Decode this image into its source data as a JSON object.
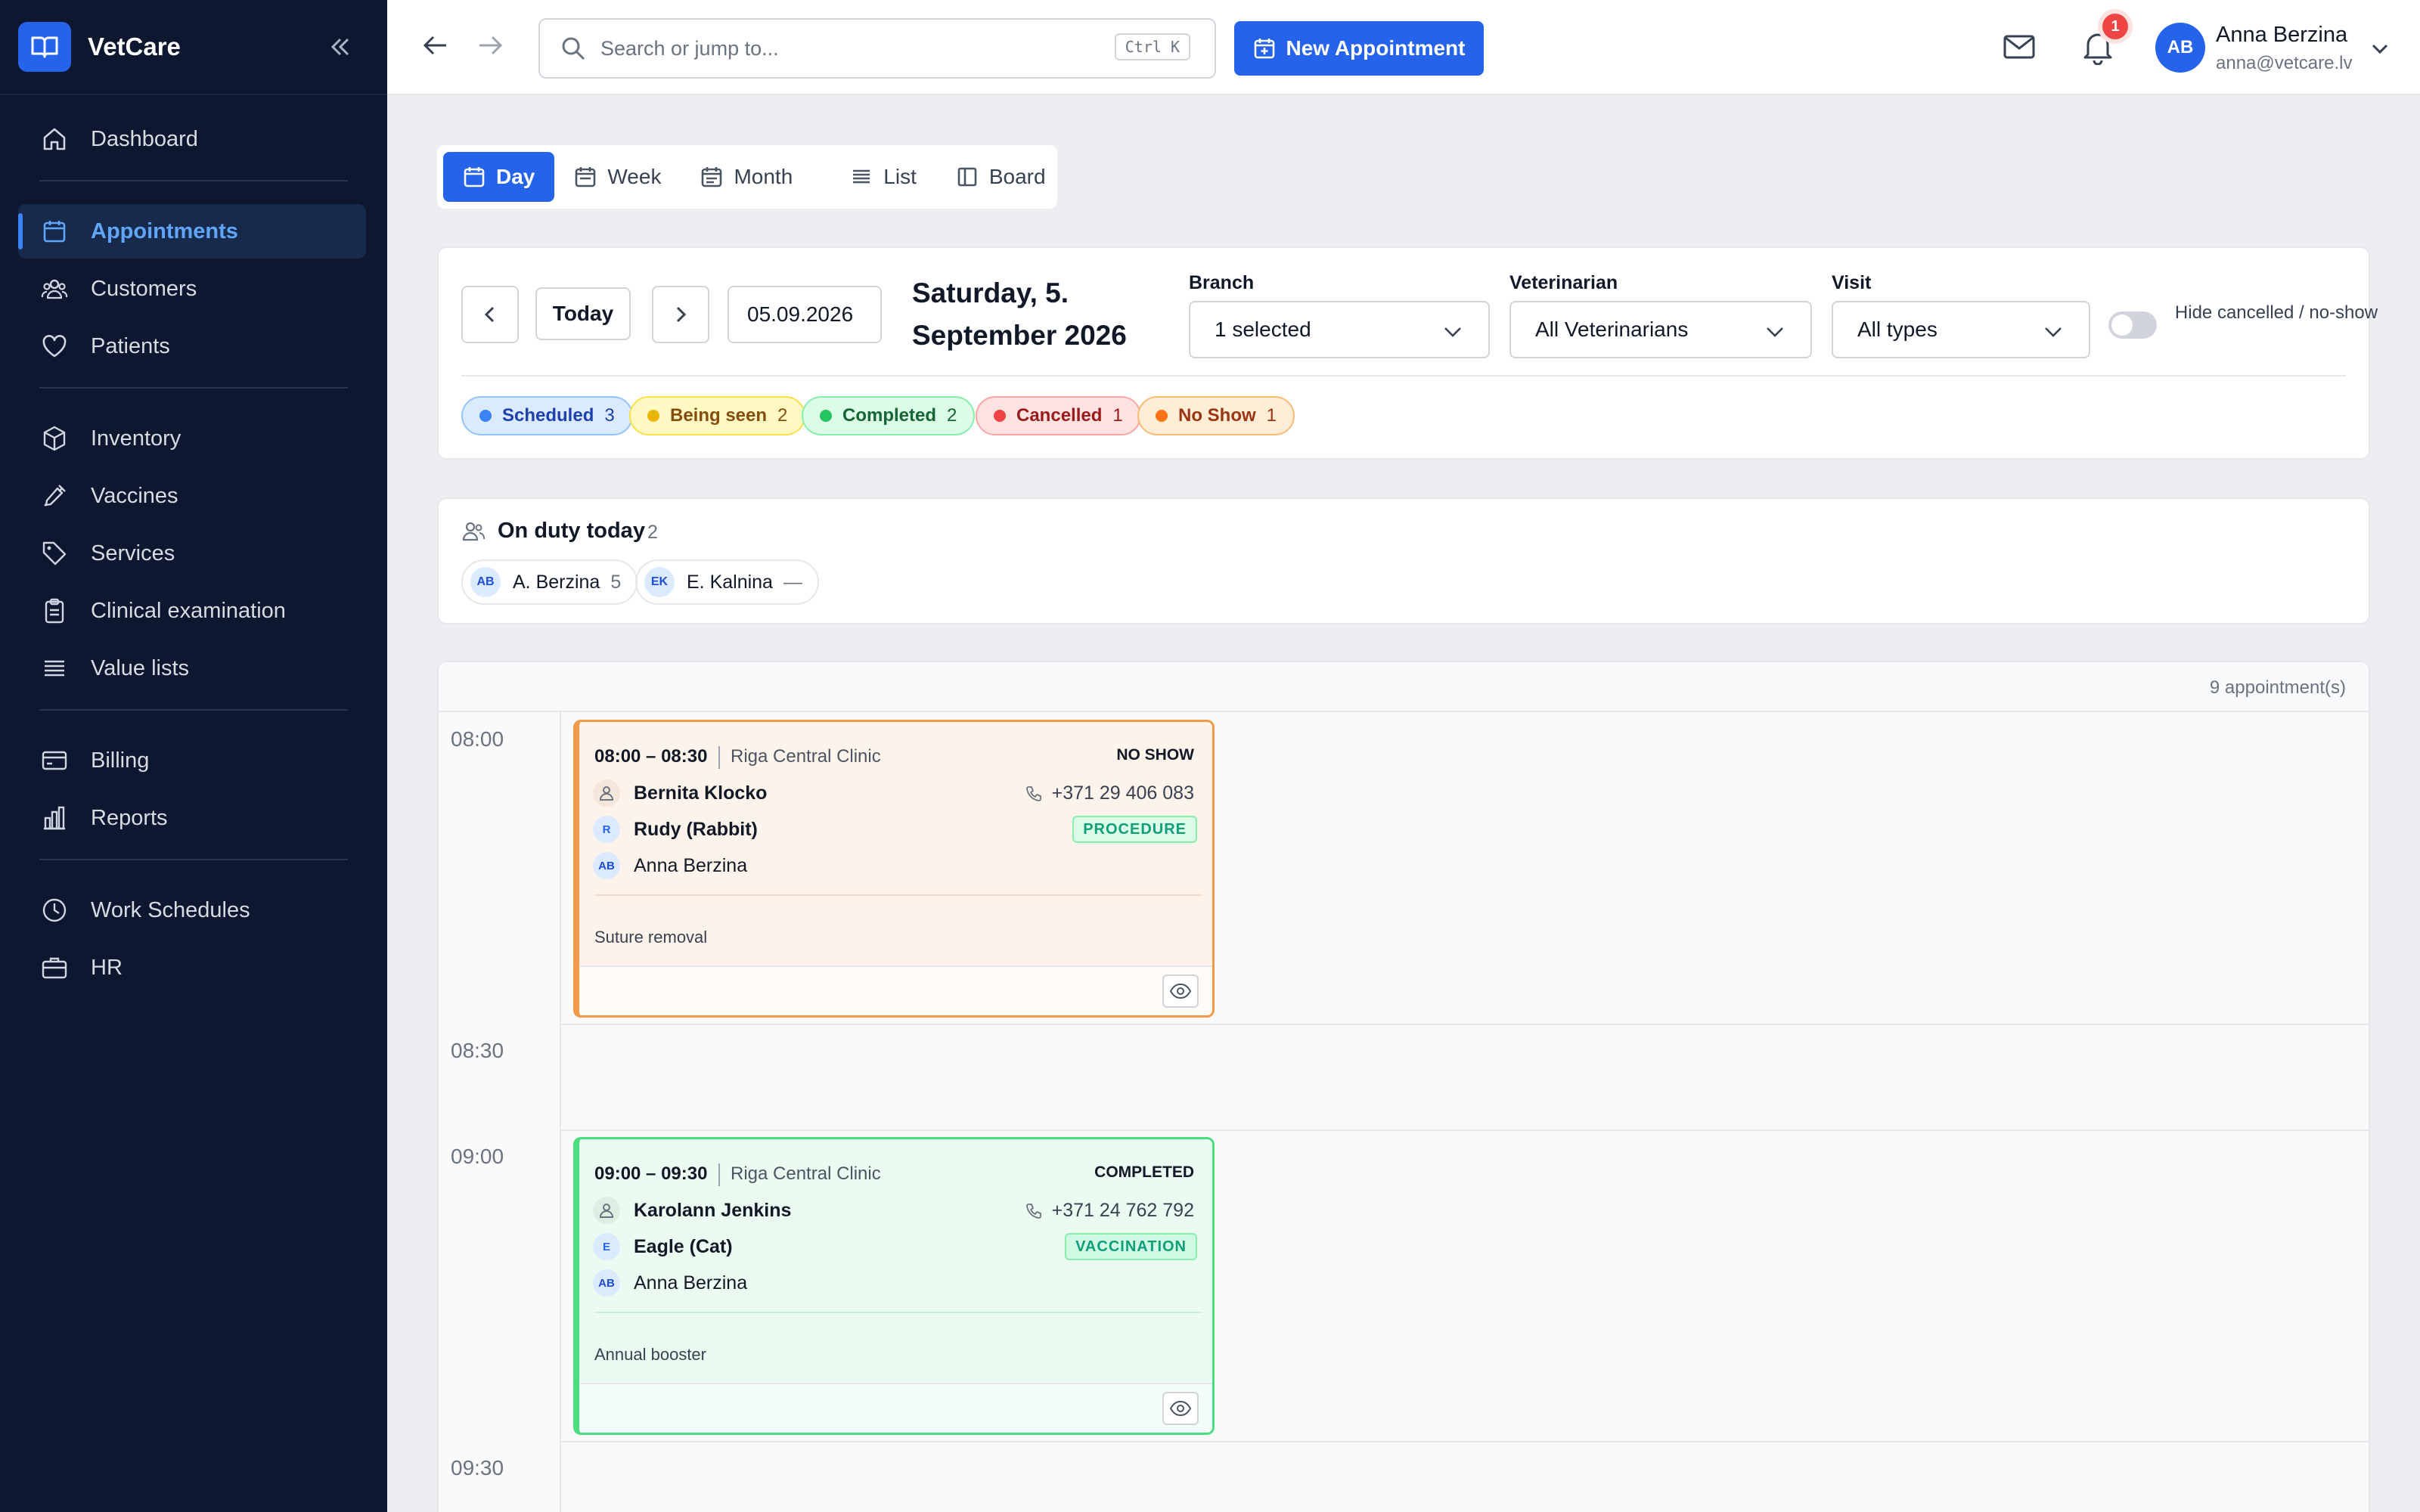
{
  "brand": {
    "name": "VetCare"
  },
  "nav": {
    "group1": [
      {
        "label": "Dashboard",
        "icon": "home-icon"
      }
    ],
    "group2": [
      {
        "label": "Appointments",
        "icon": "calendar-icon"
      },
      {
        "label": "Customers",
        "icon": "users-icon"
      },
      {
        "label": "Patients",
        "icon": "heart-icon"
      }
    ],
    "group3": [
      {
        "label": "Inventory",
        "icon": "box-icon"
      },
      {
        "label": "Vaccines",
        "icon": "syringe-icon"
      },
      {
        "label": "Services",
        "icon": "tag-icon"
      },
      {
        "label": "Clinical examination",
        "icon": "clipboard-icon"
      },
      {
        "label": "Value lists",
        "icon": "list-icon"
      }
    ],
    "group4": [
      {
        "label": "Billing",
        "icon": "card-icon"
      },
      {
        "label": "Reports",
        "icon": "bar-chart-icon"
      }
    ],
    "group5": [
      {
        "label": "Work Schedules",
        "icon": "clock-icon"
      },
      {
        "label": "HR",
        "icon": "briefcase-icon"
      }
    ]
  },
  "topbar": {
    "search_placeholder": "Search or jump to...",
    "search_shortcut": "Ctrl K",
    "new_appointment": "New Appointment",
    "notification_count": "1",
    "user": {
      "initials": "AB",
      "name": "Anna Berzina",
      "email": "anna@vetcare.lv"
    }
  },
  "views": [
    "Day",
    "Week",
    "Month",
    "List",
    "Board"
  ],
  "filters": {
    "today": "Today",
    "date": "05.09.2026",
    "date_title": "Saturday, 5. September 2026",
    "branch": {
      "label": "Branch",
      "value": "1 selected"
    },
    "vet": {
      "label": "Veterinarian",
      "value": "All Veterinarians"
    },
    "visit": {
      "label": "Visit",
      "value": "All types"
    },
    "hide_label": "Hide cancelled / no-show",
    "statuses": [
      {
        "label": "Scheduled",
        "count": "3",
        "color": "#3b82f6"
      },
      {
        "label": "Being seen",
        "count": "2",
        "color": "#eab308"
      },
      {
        "label": "Completed",
        "count": "2",
        "color": "#22c55e"
      },
      {
        "label": "Cancelled",
        "count": "1",
        "color": "#ef4444"
      },
      {
        "label": "No Show",
        "count": "1",
        "color": "#f97316"
      }
    ]
  },
  "duty": {
    "title": "On duty today",
    "count": "2",
    "staff": [
      {
        "initials": "AB",
        "name": "A. Berzina",
        "count": "5"
      },
      {
        "initials": "EK",
        "name": "E. Kalnina",
        "count": "—"
      }
    ]
  },
  "schedule": {
    "total": "9 appointment(s)",
    "times": [
      "08:00",
      "08:30",
      "09:00",
      "09:30"
    ],
    "appointments": [
      {
        "time": "08:00 – 08:30",
        "location": "Riga Central Clinic",
        "status": "NO SHOW",
        "customer": "Bernita Klocko",
        "phone": "+371 29 406 083",
        "patient": "Rudy (Rabbit)",
        "patient_initial": "R",
        "vet_initials": "AB",
        "vet": "Anna Berzina",
        "type": "PROCEDURE",
        "note": "Suture removal"
      },
      {
        "time": "09:00 – 09:30",
        "location": "Riga Central Clinic",
        "status": "COMPLETED",
        "customer": "Karolann Jenkins",
        "phone": "+371 24 762 792",
        "patient": "Eagle (Cat)",
        "patient_initial": "E",
        "vet_initials": "AB",
        "vet": "Anna Berzina",
        "type": "VACCINATION",
        "note": "Annual booster"
      }
    ]
  }
}
